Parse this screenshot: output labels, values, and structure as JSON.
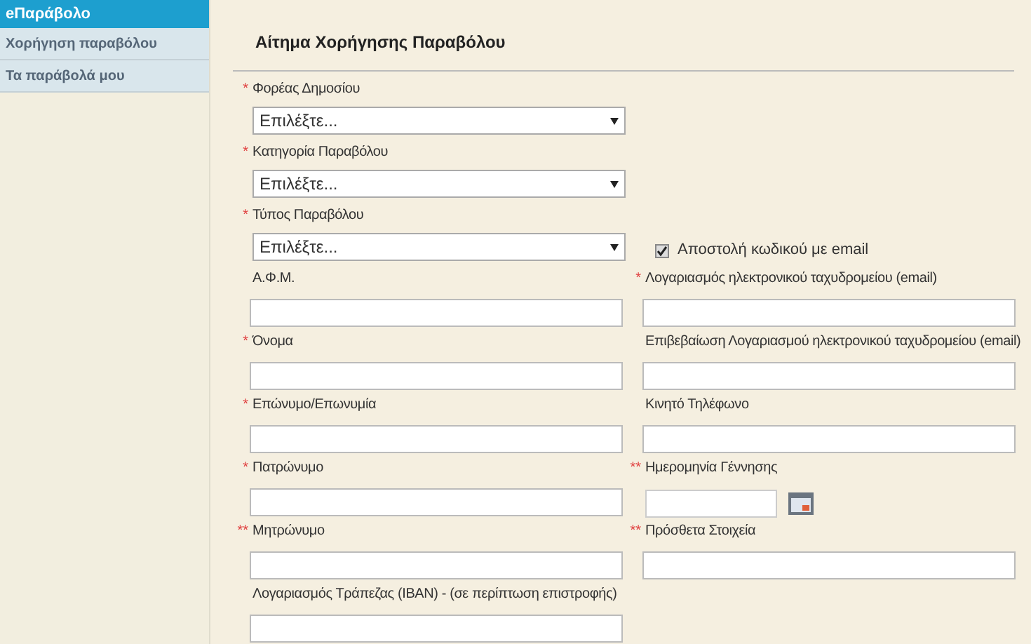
{
  "sidebar": {
    "title": "eΠαράβολο",
    "items": [
      {
        "label": "Χορήγηση παραβόλου",
        "selected": false
      },
      {
        "label": "Τα παράβολά μου",
        "selected": false
      }
    ]
  },
  "form": {
    "title": "Αίτημα Χορήγησης Παραβόλου",
    "rows": [
      {
        "left": {
          "kind": "select",
          "marker": "*",
          "label": "Φορέας Δημοσίου",
          "value": "Επιλέξτε..."
        }
      },
      {
        "left": {
          "kind": "select",
          "marker": "*",
          "label": "Κατηγορία Παραβόλου",
          "value": "Επιλέξτε..."
        }
      },
      {
        "left": {
          "kind": "select",
          "marker": "*",
          "label": "Τύπος Παραβόλου",
          "value": "Επιλέξτε..."
        },
        "right": {
          "kind": "checkbox",
          "label": "Αποστολή κωδικού με email",
          "checked": true
        }
      },
      {
        "left": {
          "kind": "text",
          "label": "Α.Φ.Μ."
        },
        "right": {
          "kind": "text",
          "marker": "*",
          "label": "Λογαριασμός ηλεκτρονικού ταχυδρομείου (email)"
        }
      },
      {
        "left": {
          "kind": "text",
          "marker": "*",
          "label": "Όνομα"
        },
        "right": {
          "kind": "text",
          "label": "Επιβεβαίωση Λογαριασμού ηλεκτρονικού ταχυδρομείου (email)"
        }
      },
      {
        "left": {
          "kind": "text",
          "marker": "*",
          "label": "Επώνυμο/Επωνυμία"
        },
        "right": {
          "kind": "text",
          "label": "Κινητό Τηλέφωνο"
        }
      },
      {
        "left": {
          "kind": "text",
          "marker": "*",
          "label": "Πατρώνυμο"
        },
        "right": {
          "kind": "date",
          "marker": "**",
          "label": "Ημερομηνία Γέννησης"
        }
      },
      {
        "left": {
          "kind": "text",
          "marker": "**",
          "label": "Μητρώνυμο"
        },
        "right": {
          "kind": "text",
          "marker": "**",
          "label": "Πρόσθετα Στοιχεία"
        }
      },
      {
        "left": {
          "kind": "text",
          "label": "Λογαριασμός Τράπεζας (IBAN) - (σε περίπτωση επιστροφής)"
        }
      }
    ]
  }
}
